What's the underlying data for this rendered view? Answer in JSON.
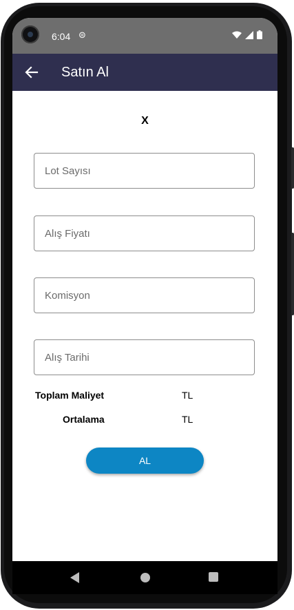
{
  "status_bar": {
    "time": "6:04",
    "sim_icon": "sim-card-icon",
    "icons": [
      "wifi-icon",
      "signal-icon",
      "battery-icon"
    ]
  },
  "app_bar": {
    "title": "Satın Al",
    "back_icon": "arrow-back-icon"
  },
  "main": {
    "x_label": "X",
    "fields": [
      {
        "placeholder": "Lot Sayısı",
        "value": ""
      },
      {
        "placeholder": "Alış Fiyatı",
        "value": ""
      },
      {
        "placeholder": "Komisyon",
        "value": ""
      },
      {
        "placeholder": "Alış Tarihi",
        "value": ""
      }
    ],
    "summary": [
      {
        "label": "Toplam Maliyet",
        "value": "TL"
      },
      {
        "label": "Ortalama",
        "value": "TL"
      }
    ],
    "button_label": "AL"
  },
  "nav_bar": {
    "icons": [
      "nav-back-icon",
      "nav-home-icon",
      "nav-recents-icon"
    ]
  },
  "colors": {
    "app_bar": "#2f2f4f",
    "status_bar": "#6e6e6e",
    "button": "#0d86c4"
  }
}
